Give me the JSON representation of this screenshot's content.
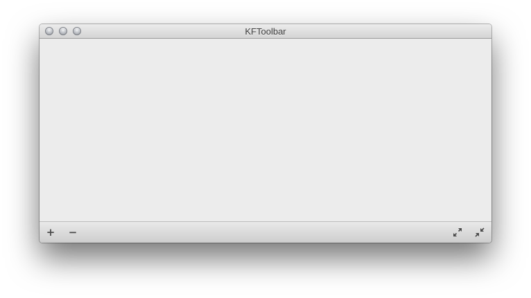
{
  "window": {
    "title": "KFToolbar"
  },
  "toolbar": {
    "add_label": "+",
    "remove_label": "−",
    "add_icon": "plus-icon",
    "remove_icon": "minus-icon",
    "expand_icon": "expand-arrows-icon",
    "contract_icon": "contract-arrows-icon"
  }
}
